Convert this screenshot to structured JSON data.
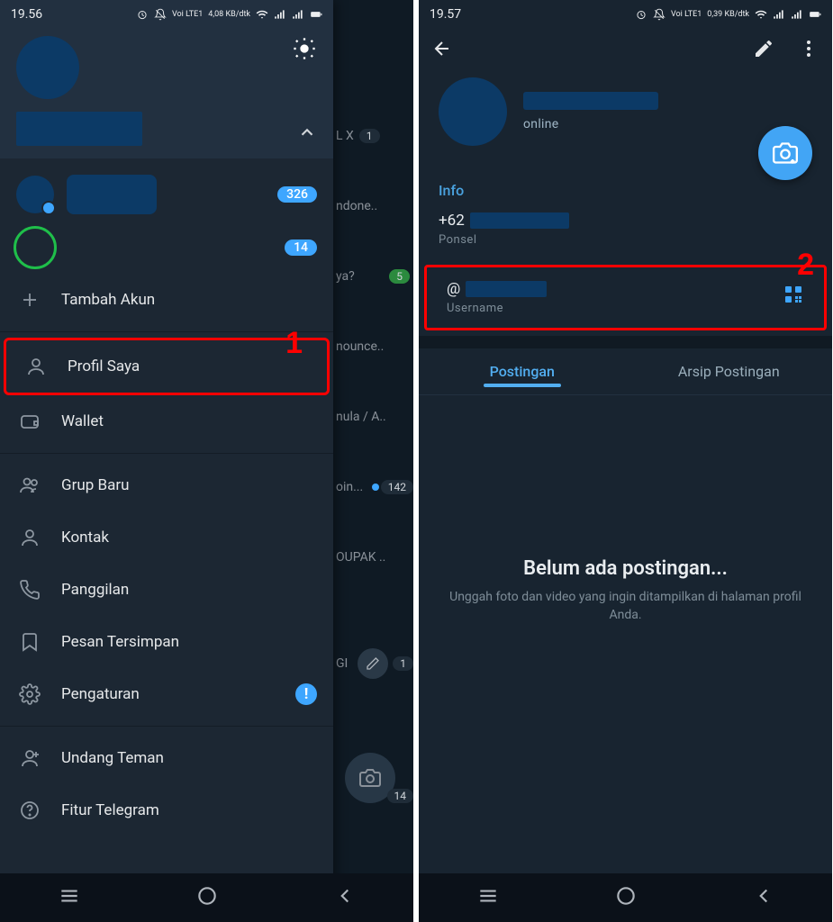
{
  "left": {
    "statusbar": {
      "time": "19.56",
      "net_label": "Voi LTE1",
      "speed": "4,08 KB/dtk"
    },
    "drawer": {
      "accounts": [
        {
          "badge": "326"
        },
        {
          "badge": "14"
        }
      ],
      "add_account": "Tambah Akun",
      "items": {
        "profile": "Profil Saya",
        "wallet": "Wallet",
        "new_group": "Grup Baru",
        "contacts": "Kontak",
        "calls": "Panggilan",
        "saved": "Pesan Tersimpan",
        "settings": "Pengaturan",
        "invite": "Undang Teman",
        "features": "Fitur Telegram"
      },
      "settings_badge": "!"
    },
    "step_label": "1",
    "chat_peek": {
      "r0": "L X",
      "r1": "ndone..",
      "r2": "ya?",
      "r3": "nounce..",
      "r4": "nula / A..",
      "r5": "oin...",
      "r5b": "142",
      "r6": "OUPAK ..",
      "r7": "GI",
      "r7b": "1",
      "r8b": "14"
    }
  },
  "right": {
    "statusbar": {
      "time": "19.57",
      "net_label": "Voi LTE1",
      "speed": "0,39 KB/dtk"
    },
    "profile": {
      "status": "online"
    },
    "info": {
      "title": "Info",
      "phone_prefix": "+62",
      "phone_label": "Ponsel",
      "username_prefix": "@",
      "username_label": "Username"
    },
    "tabs": {
      "posts": "Postingan",
      "archive": "Arsip Postingan"
    },
    "empty": {
      "title": "Belum ada postingan...",
      "sub": "Unggah foto dan video yang ingin ditampilkan di halaman profil Anda."
    },
    "step_label": "2"
  }
}
